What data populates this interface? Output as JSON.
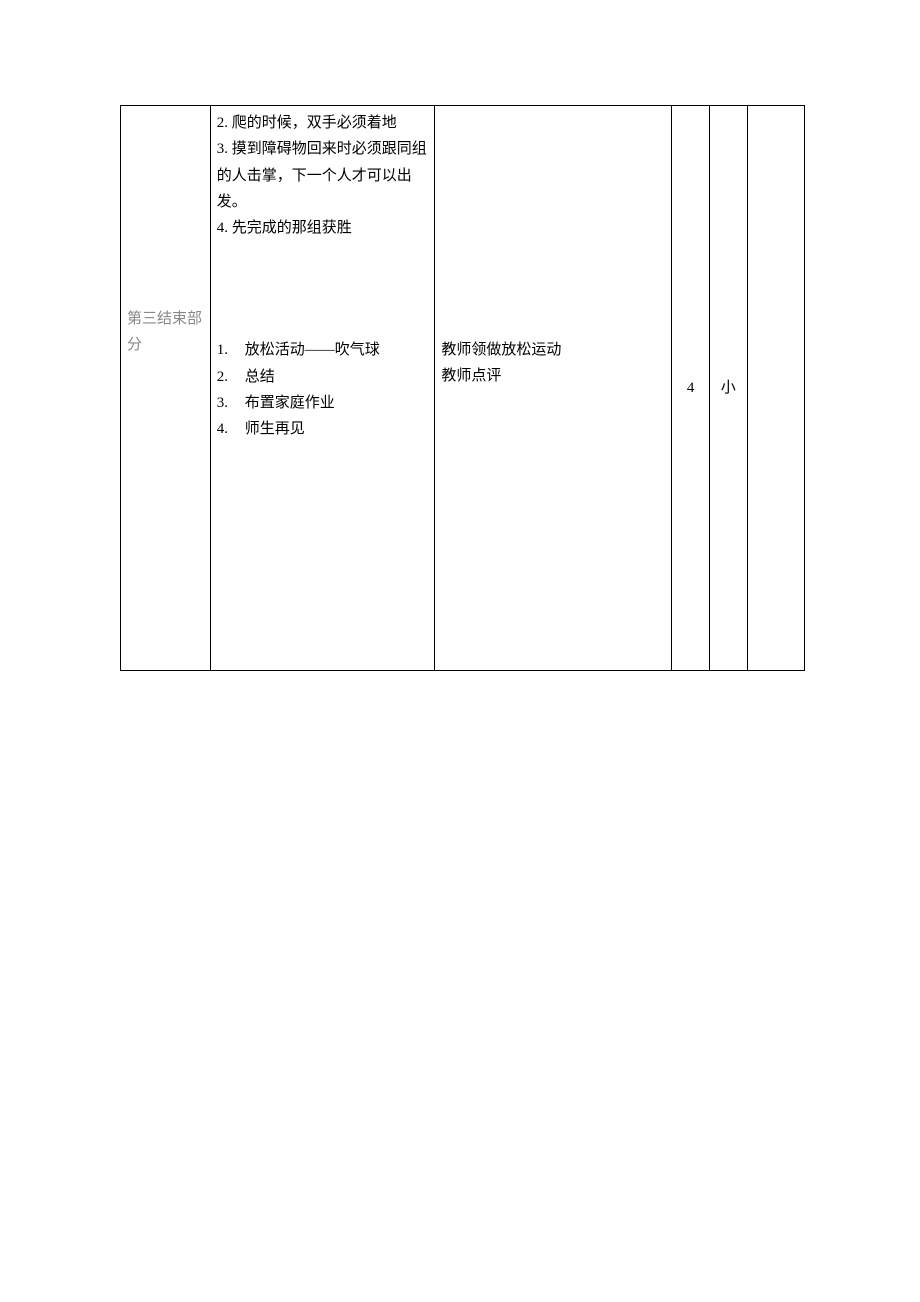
{
  "row1": {
    "col1": "",
    "col2": {
      "block1": {
        "line1": "2. 爬的时候，双手必须着地",
        "line2": "3. 摸到障碍物回来时必须跟同组的人击掌，下一个人才可以出发。",
        "line3": "4. 先完成的那组获胜"
      },
      "block2": {
        "items": [
          {
            "num": "1.",
            "text": "放松活动——吹气球"
          },
          {
            "num": "2.",
            "text": "总结"
          },
          {
            "num": "3.",
            "text": "布置家庭作业"
          },
          {
            "num": "4.",
            "text": "师生再见"
          }
        ]
      }
    },
    "col3": {
      "line1": "教师领做放松运动",
      "line2": "教师点评"
    },
    "col4": "4",
    "col5": "小",
    "col6": ""
  },
  "label_col1": "第三结束部分"
}
